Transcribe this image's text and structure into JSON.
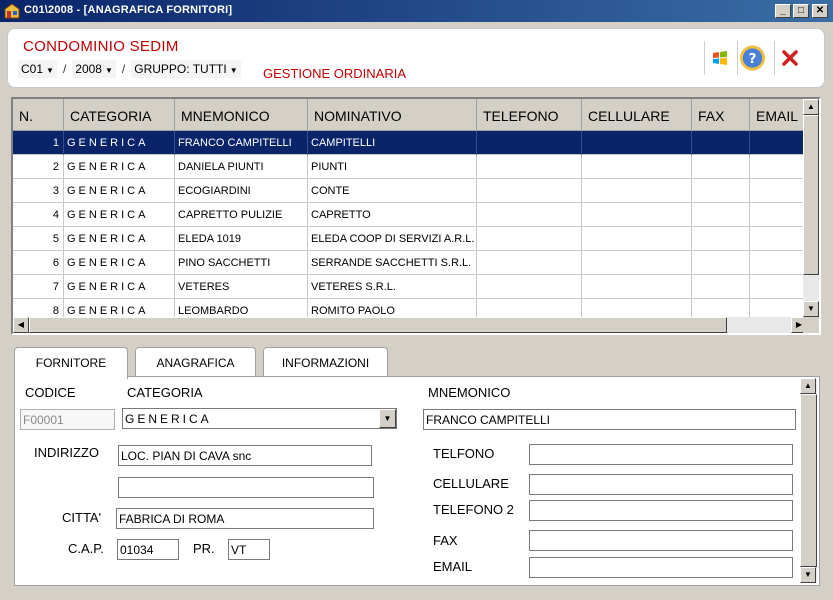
{
  "window": {
    "title": "C01\\2008 - [ANAGRAFICA FORNITORI]",
    "buttons": {
      "minimize": "_",
      "maximize": "□",
      "close": "✕"
    }
  },
  "header": {
    "company": "CONDOMINIO SEDIM",
    "selectors": {
      "code": "C01",
      "year": "2008",
      "group": "GRUPPO: TUTTI",
      "separator": "/"
    },
    "management": "GESTIONE ORDINARIA",
    "icons": [
      "windows-logo-icon",
      "help-icon",
      "close-icon"
    ]
  },
  "grid": {
    "columns": [
      "N.",
      "CATEGORIA",
      "MNEMONICO",
      "NOMINATIVO",
      "TELEFONO",
      "CELLULARE",
      "FAX",
      "EMAIL"
    ],
    "rows": [
      [
        "1",
        "GENERICA",
        "FRANCO CAMPITELLI",
        "CAMPITELLI",
        "",
        "",
        "",
        ""
      ],
      [
        "2",
        "GENERICA",
        "DANIELA PIUNTI",
        "PIUNTI",
        "",
        "",
        "",
        ""
      ],
      [
        "3",
        "GENERICA",
        "ECOGIARDINI",
        "CONTE",
        "",
        "",
        "",
        ""
      ],
      [
        "4",
        "GENERICA",
        "CAPRETTO PULIZIE",
        "CAPRETTO",
        "",
        "",
        "",
        ""
      ],
      [
        "5",
        "GENERICA",
        "ELEDA 1019",
        "ELEDA COOP DI SERVIZI A.R.L.",
        "",
        "",
        "",
        ""
      ],
      [
        "6",
        "GENERICA",
        "PINO SACCHETTI",
        "SERRANDE SACCHETTI S.R.L.",
        "",
        "",
        "",
        ""
      ],
      [
        "7",
        "GENERICA",
        "VETERES",
        "VETERES S.R.L.",
        "",
        "",
        "",
        ""
      ],
      [
        "8",
        "GENERICA",
        "LEOMBARDO",
        "ROMITO PAOLO",
        "",
        "",
        "",
        ""
      ]
    ],
    "selected_row": 0
  },
  "tabs": [
    "FORNITORE",
    "ANAGRAFICA",
    "INFORMAZIONI"
  ],
  "active_tab": 0,
  "form": {
    "codice": {
      "label": "CODICE",
      "value": "F00001"
    },
    "categoria": {
      "label": "CATEGORIA",
      "value": "GENERICA"
    },
    "mnemonico": {
      "label": "MNEMONICO",
      "value": "FRANCO CAMPITELLI"
    },
    "indirizzo": {
      "label": "INDIRIZZO",
      "value": "LOC. PIAN DI CAVA snc",
      "value2": ""
    },
    "citta": {
      "label": "CITTA'",
      "value": "FABRICA DI ROMA"
    },
    "cap": {
      "label": "C.A.P.",
      "value": "01034"
    },
    "pr": {
      "label": "PR.",
      "value": "VT"
    },
    "telefono": {
      "label": "TELFONO",
      "value": ""
    },
    "cellulare": {
      "label": "CELLULARE",
      "value": ""
    },
    "telefono2": {
      "label": "TELEFONO 2",
      "value": ""
    },
    "fax": {
      "label": "FAX",
      "value": ""
    },
    "email": {
      "label": "EMAIL",
      "value": ""
    }
  }
}
